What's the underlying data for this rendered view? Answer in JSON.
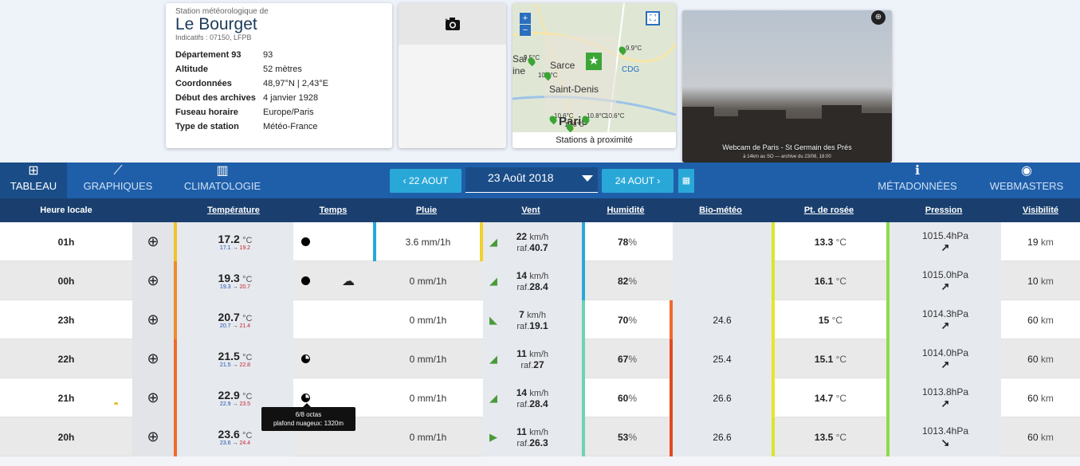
{
  "station": {
    "subtitle": "Station météorologique de",
    "name": "Le Bourget",
    "indicatifs": "Indicatifs : 07150, LFPB",
    "details": [
      {
        "key": "Département 93",
        "value": "93"
      },
      {
        "key": "Altitude",
        "value": "52 mètres"
      },
      {
        "key": "Coordonnées",
        "value": "48,97°N | 2,43°E"
      },
      {
        "key": "Début des archives",
        "value": "4 janvier 1928"
      },
      {
        "key": "Fuseau horaire",
        "value": "Europe/Paris"
      },
      {
        "key": "Type de station",
        "value": "Météo-France"
      }
    ]
  },
  "photo": {
    "icon": "camera-add-icon"
  },
  "map": {
    "zoom_in": "+",
    "zoom_out": "−",
    "caption": "Stations à proximité",
    "labels": {
      "sarcelles": "Sarce",
      "saint_denis": "Saint-Denis",
      "paris": "Paris",
      "cdg": "CDG",
      "sai": "Sai",
      "ine": "ine"
    },
    "temps": {
      "t1": "9.9°C",
      "t2": "10.3°C",
      "t3": "9.5°C",
      "t4": "10.6°C",
      "t5": "10.8°C",
      "t6": "10.8°C",
      "t7": "10.6°C"
    }
  },
  "webcam": {
    "caption": "Webcam de Paris - St Germain des Prés",
    "subcaption": "à 14km au SO — archive du 23/08, 18:00"
  },
  "nav": {
    "tabs": [
      {
        "label": "TABLEAU",
        "icon": "table-icon",
        "glyph": "⊞"
      },
      {
        "label": "GRAPHIQUES",
        "icon": "line-chart-icon",
        "glyph": "⟋"
      },
      {
        "label": "CLIMATOLOGIE",
        "icon": "bar-chart-icon",
        "glyph": "▥"
      },
      {
        "label": "MÉTADONNÉES",
        "icon": "info-icon",
        "glyph": "ℹ"
      },
      {
        "label": "WEBMASTERS",
        "icon": "globe-icon",
        "glyph": "◉"
      }
    ],
    "prev_day": "‹ 22 AOUT",
    "current_date": "23 Août 2018",
    "next_day": "24 AOUT ›"
  },
  "table": {
    "headers": [
      "Heure locale",
      "Température",
      "Temps",
      "Pluie",
      "Vent",
      "Humidité",
      "Bio-météo",
      "Pt. de rosée",
      "Pression",
      "Visibilité"
    ],
    "rows": [
      {
        "hour": "01h",
        "temp": "17.2",
        "tunit": "°C",
        "tmin": "17.1",
        "tmax": "19.2",
        "rain": "3.6 mm/1h",
        "wind": "22",
        "wunit": "km/h",
        "raf_label": "raf.",
        "raf": "40.7",
        "hum": "78",
        "bio": "",
        "dew": "13.3",
        "press": "1015.4",
        "punit": "hPa",
        "parrow": "↗",
        "vis": "19",
        "vunit": "km"
      },
      {
        "hour": "00h",
        "temp": "19.3",
        "tunit": "°C",
        "tmin": "19.3",
        "tmax": "20.7",
        "rain": "0 mm/1h",
        "wind": "14",
        "wunit": "km/h",
        "raf_label": "raf.",
        "raf": "28.4",
        "hum": "82",
        "bio": "",
        "dew": "16.1",
        "press": "1015.0",
        "punit": "hPa",
        "parrow": "↗",
        "vis": "10",
        "vunit": "km"
      },
      {
        "hour": "23h",
        "temp": "20.7",
        "tunit": "°C",
        "tmin": "20.7",
        "tmax": "21.4",
        "rain": "0 mm/1h",
        "wind": "7",
        "wunit": "km/h",
        "raf_label": "raf.",
        "raf": "19.1",
        "hum": "70",
        "bio": "24.6",
        "dew": "15",
        "press": "1014.3",
        "punit": "hPa",
        "parrow": "↗",
        "vis": "60",
        "vunit": "km"
      },
      {
        "hour": "22h",
        "temp": "21.5",
        "tunit": "°C",
        "tmin": "21.5",
        "tmax": "22.8",
        "rain": "0 mm/1h",
        "wind": "11",
        "wunit": "km/h",
        "raf_label": "raf.",
        "raf": "27",
        "hum": "67",
        "bio": "25.4",
        "dew": "15.1",
        "press": "1014.0",
        "punit": "hPa",
        "parrow": "↗",
        "vis": "60",
        "vunit": "km"
      },
      {
        "hour": "21h",
        "temp": "22.9",
        "tunit": "°C",
        "tmin": "22.9",
        "tmax": "23.5",
        "rain": "0 mm/1h",
        "wind": "14",
        "wunit": "km/h",
        "raf_label": "raf.",
        "raf": "28.4",
        "hum": "60",
        "bio": "26.6",
        "dew": "14.7",
        "press": "1013.8",
        "punit": "hPa",
        "parrow": "↗",
        "vis": "60",
        "vunit": "km"
      },
      {
        "hour": "20h",
        "temp": "23.6",
        "tunit": "°C",
        "tmin": "23.6",
        "tmax": "24.4",
        "rain": "0 mm/1h",
        "wind": "11",
        "wunit": "km/h",
        "raf_label": "raf.",
        "raf": "26.3",
        "hum": "53",
        "bio": "26.6",
        "dew": "13.5",
        "press": "1013.4",
        "punit": "hPa",
        "parrow": "↘",
        "vis": "60",
        "vunit": "km"
      }
    ],
    "arrow_sep": "→",
    "percent": "%"
  },
  "tooltip": {
    "line1": "6/8 octas",
    "line2": "plafond nuageux: 1320m"
  },
  "colors": {
    "nav": "#1f5fa9",
    "header": "#1a3f6e",
    "button": "#29a8d8"
  }
}
